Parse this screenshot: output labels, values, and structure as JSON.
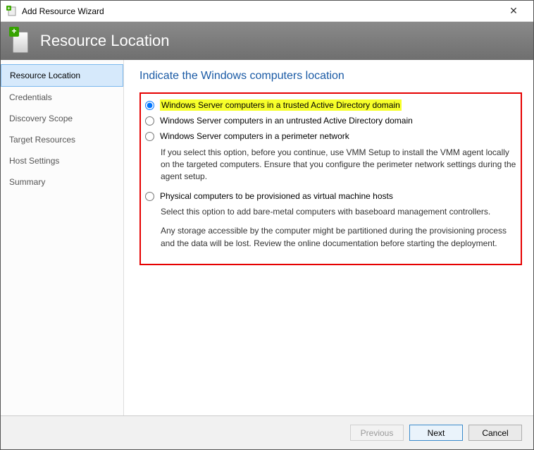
{
  "window_title": "Add Resource Wizard",
  "header_title": "Resource Location",
  "sidebar": {
    "items": [
      {
        "label": "Resource Location",
        "active": true
      },
      {
        "label": "Credentials",
        "active": false
      },
      {
        "label": "Discovery Scope",
        "active": false
      },
      {
        "label": "Target Resources",
        "active": false
      },
      {
        "label": "Host Settings",
        "active": false
      },
      {
        "label": "Summary",
        "active": false
      }
    ]
  },
  "content_heading": "Indicate the Windows computers location",
  "options": {
    "opt1": {
      "label": "Windows Server computers in a trusted Active Directory domain",
      "selected": true,
      "highlighted": true
    },
    "opt2": {
      "label": "Windows Server computers in an untrusted Active Directory domain"
    },
    "opt3": {
      "label": "Windows Server computers in a perimeter network",
      "desc": "If you select this option, before you continue, use VMM Setup to install the VMM agent locally on the targeted computers. Ensure that you configure the perimeter network settings during the agent setup."
    },
    "opt4": {
      "label": "Physical computers to be provisioned as virtual machine hosts",
      "desc1": "Select this option to add bare-metal computers with baseboard management controllers.",
      "desc2": "Any storage accessible by the computer might be partitioned during the provisioning process and the data will be lost. Review the online documentation before starting the deployment."
    }
  },
  "buttons": {
    "previous": "Previous",
    "next": "Next",
    "cancel": "Cancel"
  }
}
